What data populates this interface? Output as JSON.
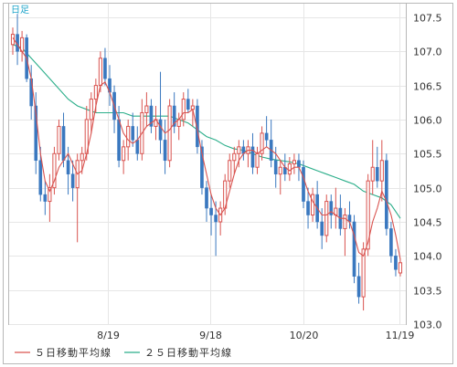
{
  "chart_data": {
    "type": "candlestick",
    "period_label": "日足",
    "y_ticks": [
      "107.5",
      "107.0",
      "106.5",
      "106.0",
      "105.5",
      "105.0",
      "104.5",
      "104.0",
      "103.5",
      "103.0"
    ],
    "x_ticks": [
      "8/19",
      "9/18",
      "10/20",
      "11/19"
    ],
    "ylim": [
      103.0,
      107.7
    ],
    "grid": true,
    "colors": {
      "up": "#d9534f",
      "down": "#3a78bf",
      "ma5": "#d9534f",
      "ma25": "#2bae8a",
      "grid": "#e6e6e6",
      "label": "#1aa3c9"
    },
    "candles": [
      [
        107.1,
        107.35,
        106.95,
        107.25
      ],
      [
        107.25,
        107.55,
        106.8,
        107.0
      ],
      [
        107.0,
        107.3,
        106.85,
        107.2
      ],
      [
        107.2,
        107.25,
        106.55,
        106.6
      ],
      [
        106.6,
        106.8,
        106.0,
        106.2
      ],
      [
        106.2,
        106.4,
        105.2,
        105.4
      ],
      [
        105.4,
        105.6,
        104.8,
        104.9
      ],
      [
        104.9,
        105.1,
        104.6,
        104.8
      ],
      [
        104.8,
        105.2,
        104.5,
        105.0
      ],
      [
        105.0,
        105.6,
        104.9,
        105.5
      ],
      [
        105.5,
        106.0,
        105.4,
        105.9
      ],
      [
        105.9,
        106.1,
        105.3,
        105.4
      ],
      [
        105.4,
        105.6,
        104.9,
        105.2
      ],
      [
        105.2,
        105.4,
        104.8,
        105.0
      ],
      [
        105.0,
        105.5,
        104.2,
        105.4
      ],
      [
        105.4,
        105.6,
        105.2,
        105.5
      ],
      [
        105.5,
        106.2,
        105.4,
        106.0
      ],
      [
        106.0,
        106.4,
        105.8,
        106.3
      ],
      [
        106.3,
        106.6,
        106.1,
        106.5
      ],
      [
        106.5,
        107.0,
        106.4,
        106.9
      ],
      [
        106.9,
        107.05,
        106.5,
        106.6
      ],
      [
        106.6,
        106.8,
        106.2,
        106.4
      ],
      [
        106.4,
        106.5,
        105.8,
        106.0
      ],
      [
        106.0,
        106.2,
        105.3,
        105.4
      ],
      [
        105.4,
        105.7,
        105.2,
        105.6
      ],
      [
        105.6,
        106.0,
        105.4,
        105.9
      ],
      [
        105.9,
        106.1,
        105.6,
        105.7
      ],
      [
        105.7,
        105.9,
        105.4,
        105.5
      ],
      [
        105.5,
        106.3,
        105.4,
        106.1
      ],
      [
        106.1,
        106.4,
        105.9,
        106.2
      ],
      [
        106.2,
        106.3,
        105.8,
        105.9
      ],
      [
        105.9,
        106.2,
        105.7,
        106.0
      ],
      [
        106.0,
        106.7,
        105.5,
        105.7
      ],
      [
        105.7,
        106.0,
        105.2,
        105.4
      ],
      [
        105.4,
        106.3,
        105.3,
        106.2
      ],
      [
        106.2,
        106.4,
        105.8,
        105.9
      ],
      [
        105.9,
        106.1,
        105.7,
        106.0
      ],
      [
        106.0,
        106.4,
        105.9,
        106.3
      ],
      [
        106.3,
        106.45,
        106.1,
        106.15
      ],
      [
        106.15,
        106.3,
        105.9,
        106.2
      ],
      [
        106.2,
        106.3,
        105.5,
        105.6
      ],
      [
        105.6,
        105.7,
        104.9,
        105.0
      ],
      [
        105.0,
        105.1,
        104.5,
        104.7
      ],
      [
        104.7,
        104.9,
        104.3,
        104.6
      ],
      [
        104.6,
        104.8,
        104.0,
        104.5
      ],
      [
        104.5,
        104.8,
        104.3,
        104.7
      ],
      [
        104.7,
        105.2,
        104.6,
        105.1
      ],
      [
        105.1,
        105.5,
        105.0,
        105.4
      ],
      [
        105.4,
        105.6,
        105.2,
        105.5
      ],
      [
        105.5,
        105.7,
        105.3,
        105.6
      ],
      [
        105.6,
        105.7,
        105.4,
        105.5
      ],
      [
        105.5,
        105.7,
        105.3,
        105.6
      ],
      [
        105.6,
        105.8,
        105.2,
        105.3
      ],
      [
        105.3,
        105.6,
        105.2,
        105.5
      ],
      [
        105.5,
        105.9,
        105.4,
        105.8
      ],
      [
        105.8,
        106.05,
        105.6,
        105.7
      ],
      [
        105.7,
        106.0,
        105.3,
        105.4
      ],
      [
        105.4,
        105.6,
        105.0,
        105.2
      ],
      [
        105.2,
        105.4,
        104.9,
        105.3
      ],
      [
        105.3,
        105.5,
        105.1,
        105.2
      ],
      [
        105.2,
        105.45,
        105.1,
        105.35
      ],
      [
        105.35,
        105.5,
        105.2,
        105.4
      ],
      [
        105.4,
        105.5,
        105.1,
        105.3
      ],
      [
        105.3,
        105.4,
        104.7,
        104.8
      ],
      [
        104.8,
        105.0,
        104.4,
        104.6
      ],
      [
        104.6,
        105.0,
        104.5,
        104.9
      ],
      [
        104.9,
        105.1,
        104.4,
        104.5
      ],
      [
        104.5,
        104.7,
        104.1,
        104.3
      ],
      [
        104.3,
        104.9,
        104.2,
        104.8
      ],
      [
        104.8,
        104.9,
        104.4,
        104.6
      ],
      [
        104.6,
        105.0,
        104.4,
        104.7
      ],
      [
        104.7,
        104.9,
        104.3,
        104.4
      ],
      [
        104.4,
        104.7,
        104.0,
        104.6
      ],
      [
        104.6,
        104.8,
        104.4,
        104.5
      ],
      [
        104.5,
        104.6,
        103.6,
        103.7
      ],
      [
        103.7,
        103.9,
        103.3,
        103.4
      ],
      [
        103.4,
        104.2,
        103.2,
        104.1
      ],
      [
        104.1,
        105.2,
        104.0,
        105.1
      ],
      [
        105.1,
        105.7,
        104.9,
        105.3
      ],
      [
        105.3,
        105.6,
        105.0,
        105.1
      ],
      [
        105.1,
        105.7,
        104.8,
        105.4
      ],
      [
        105.4,
        105.5,
        104.3,
        104.4
      ],
      [
        104.4,
        104.5,
        103.9,
        104.0
      ],
      [
        104.0,
        104.1,
        103.7,
        103.8
      ],
      [
        103.75,
        103.95,
        103.7,
        103.9
      ]
    ],
    "ma5": [
      [
        0,
        107.2
      ],
      [
        1,
        107.1
      ],
      [
        2,
        107.0
      ],
      [
        3,
        106.9
      ],
      [
        4,
        106.6
      ],
      [
        5,
        106.1
      ],
      [
        6,
        105.5
      ],
      [
        7,
        105.1
      ],
      [
        8,
        104.95
      ],
      [
        9,
        105.1
      ],
      [
        10,
        105.3
      ],
      [
        11,
        105.4
      ],
      [
        12,
        105.5
      ],
      [
        13,
        105.35
      ],
      [
        14,
        105.2
      ],
      [
        15,
        105.25
      ],
      [
        16,
        105.5
      ],
      [
        17,
        105.8
      ],
      [
        18,
        106.2
      ],
      [
        19,
        106.5
      ],
      [
        20,
        106.55
      ],
      [
        21,
        106.4
      ],
      [
        22,
        106.2
      ],
      [
        23,
        106.0
      ],
      [
        24,
        105.8
      ],
      [
        25,
        105.7
      ],
      [
        26,
        105.65
      ],
      [
        27,
        105.7
      ],
      [
        28,
        105.8
      ],
      [
        29,
        105.9
      ],
      [
        30,
        105.95
      ],
      [
        31,
        106.0
      ],
      [
        32,
        105.9
      ],
      [
        33,
        105.8
      ],
      [
        34,
        105.85
      ],
      [
        35,
        105.95
      ],
      [
        36,
        106.0
      ],
      [
        37,
        106.1
      ],
      [
        38,
        106.1
      ],
      [
        39,
        106.15
      ],
      [
        40,
        105.85
      ],
      [
        41,
        105.5
      ],
      [
        42,
        105.2
      ],
      [
        43,
        104.9
      ],
      [
        44,
        104.7
      ],
      [
        45,
        104.6
      ],
      [
        46,
        104.7
      ],
      [
        47,
        104.95
      ],
      [
        48,
        105.2
      ],
      [
        49,
        105.4
      ],
      [
        50,
        105.5
      ],
      [
        51,
        105.55
      ],
      [
        52,
        105.55
      ],
      [
        53,
        105.5
      ],
      [
        54,
        105.55
      ],
      [
        55,
        105.6
      ],
      [
        56,
        105.55
      ],
      [
        57,
        105.5
      ],
      [
        58,
        105.4
      ],
      [
        59,
        105.3
      ],
      [
        60,
        105.25
      ],
      [
        61,
        105.3
      ],
      [
        62,
        105.3
      ],
      [
        63,
        105.15
      ],
      [
        64,
        104.95
      ],
      [
        65,
        104.8
      ],
      [
        66,
        104.7
      ],
      [
        67,
        104.6
      ],
      [
        68,
        104.6
      ],
      [
        69,
        104.65
      ],
      [
        70,
        104.6
      ],
      [
        71,
        104.55
      ],
      [
        72,
        104.55
      ],
      [
        73,
        104.5
      ],
      [
        74,
        104.3
      ],
      [
        75,
        104.05
      ],
      [
        76,
        104.0
      ],
      [
        77,
        104.2
      ],
      [
        78,
        104.5
      ],
      [
        79,
        104.7
      ],
      [
        80,
        104.95
      ],
      [
        81,
        104.8
      ],
      [
        82,
        104.6
      ],
      [
        83,
        104.3
      ],
      [
        84,
        103.95
      ]
    ],
    "ma25": [
      [
        0,
        107.1
      ],
      [
        2,
        107.05
      ],
      [
        4,
        106.9
      ],
      [
        6,
        106.75
      ],
      [
        8,
        106.6
      ],
      [
        10,
        106.45
      ],
      [
        12,
        106.3
      ],
      [
        14,
        106.2
      ],
      [
        16,
        106.15
      ],
      [
        18,
        106.1
      ],
      [
        20,
        106.1
      ],
      [
        22,
        106.1
      ],
      [
        24,
        106.1
      ],
      [
        26,
        106.05
      ],
      [
        28,
        106.05
      ],
      [
        30,
        106.05
      ],
      [
        32,
        106.05
      ],
      [
        34,
        106.05
      ],
      [
        36,
        106.0
      ],
      [
        38,
        105.95
      ],
      [
        40,
        105.85
      ],
      [
        42,
        105.75
      ],
      [
        44,
        105.7
      ],
      [
        46,
        105.62
      ],
      [
        48,
        105.57
      ],
      [
        50,
        105.55
      ],
      [
        52,
        105.5
      ],
      [
        54,
        105.45
      ],
      [
        56,
        105.42
      ],
      [
        58,
        105.4
      ],
      [
        60,
        105.38
      ],
      [
        62,
        105.35
      ],
      [
        64,
        105.3
      ],
      [
        66,
        105.25
      ],
      [
        68,
        105.2
      ],
      [
        70,
        105.15
      ],
      [
        72,
        105.1
      ],
      [
        74,
        105.05
      ],
      [
        76,
        104.95
      ],
      [
        78,
        104.9
      ],
      [
        80,
        104.85
      ],
      [
        82,
        104.75
      ],
      [
        84,
        104.55
      ]
    ]
  },
  "legend": {
    "ma5": "５日移動平均線",
    "ma25": "２５日移動平均線"
  }
}
